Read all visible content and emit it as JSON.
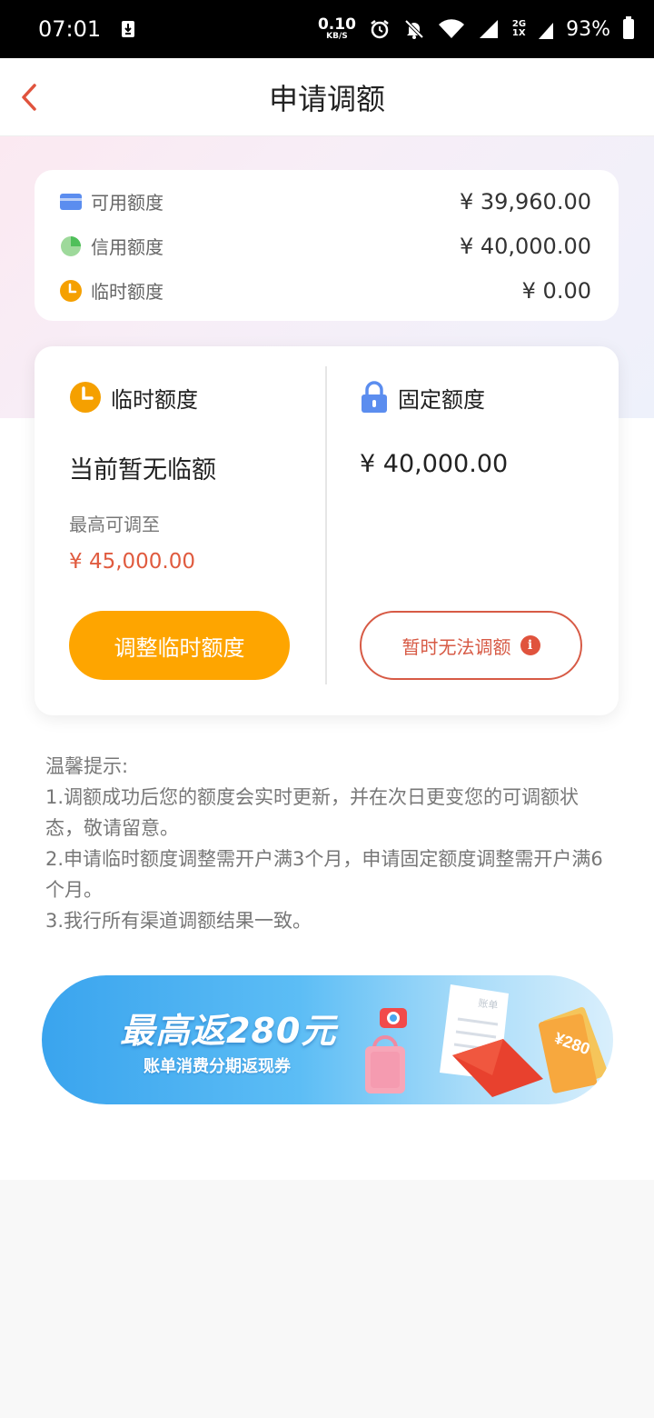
{
  "status_bar": {
    "time": "07:01",
    "net_speed": "0.10",
    "net_unit": "KB/S",
    "sim_top": "2G",
    "sim_bottom": "1X",
    "battery": "93%"
  },
  "header": {
    "title": "申请调额"
  },
  "summary": [
    {
      "label": "可用额度",
      "value": "¥ 39,960.00",
      "icon": "card-icon"
    },
    {
      "label": "信用额度",
      "value": "¥ 40,000.00",
      "icon": "pie-icon"
    },
    {
      "label": "临时额度",
      "value": "¥ 0.00",
      "icon": "clock-icon"
    }
  ],
  "temporary": {
    "label": "临时额度",
    "status": "当前暂无临额",
    "max_label": "最高可调至",
    "max_value": "¥ 45,000.00",
    "button": "调整临时额度"
  },
  "fixed": {
    "label": "固定额度",
    "value": "¥ 40,000.00",
    "button": "暂时无法调额",
    "info_symbol": "i"
  },
  "tips": {
    "title": "温馨提示:",
    "items": [
      "1.调额成功后您的额度会实时更新，并在次日更变您的可调额状态，敬请留意。",
      "2.申请临时额度调整需开户满3个月，申请固定额度调整需开户满6个月。",
      "3.我行所有渠道调额结果一致。"
    ]
  },
  "banner": {
    "title": "最高返280元",
    "subtitle": "账单消费分期返现券",
    "bill_text": "账单",
    "coupon_text": "¥280"
  },
  "colors": {
    "accent_orange": "#fea500",
    "accent_red": "#e05b3f",
    "back_arrow": "#e0533d"
  }
}
